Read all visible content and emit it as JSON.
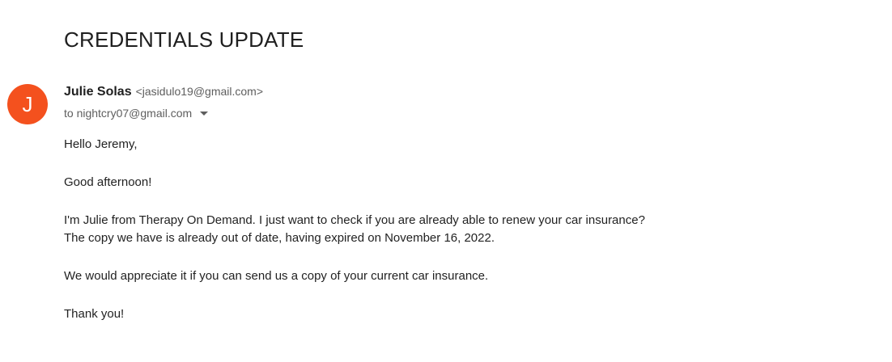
{
  "email": {
    "subject": "CREDENTIALS UPDATE",
    "sender": {
      "avatar_letter": "J",
      "avatar_color": "#f4511e",
      "name": "Julie Solas",
      "email": "<jasidulo19@gmail.com>"
    },
    "recipient_line": "to nightcry07@gmail.com",
    "body": {
      "greeting": "Hello Jeremy,",
      "salutation": "Good afternoon!",
      "paragraph1_line1": "I'm Julie from Therapy On Demand. I just want to check if you are already able to renew your car insurance?",
      "paragraph1_line2": "The copy we have is already out of date, having expired on November 16, 2022.",
      "paragraph2": "We would appreciate it if you can send us a copy of your current car insurance.",
      "closing": "Thank you!"
    }
  }
}
